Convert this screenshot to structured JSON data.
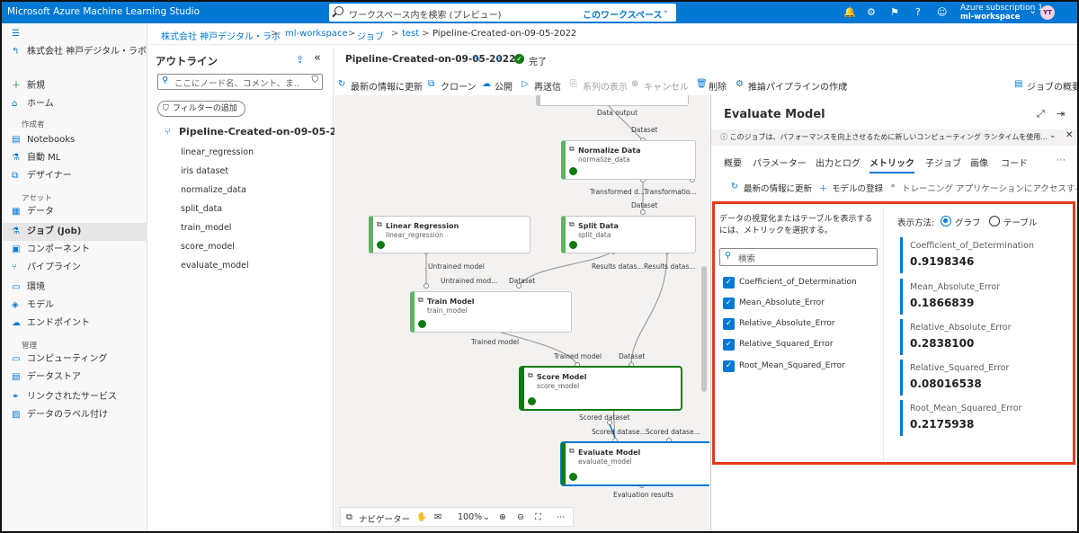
{
  "app": {
    "title": "Microsoft Azure Machine Learning Studio",
    "search_placeholder": "ワークスペース内を検索 (プレビュー)",
    "search_scope": "このワークスペース",
    "subscription": "Azure subscription 1",
    "workspace": "ml-workspace",
    "avatar_initials": "YT"
  },
  "breadcrumb": {
    "items": [
      "株式会社 神戸デジタル・ラボ",
      "ml-workspace",
      "ジョブ",
      "test",
      "Pipeline-Created-on-09-05-2022"
    ],
    "sep": ">"
  },
  "leftnav": {
    "org": "株式会社 神戸デジタル・ラボ",
    "new": "新規",
    "home": "ホーム",
    "section_author": "作成者",
    "notebooks": "Notebooks",
    "automl": "自動 ML",
    "designer": "デザイナー",
    "section_assets": "アセット",
    "data": "データ",
    "jobs": "ジョブ (Job)",
    "components": "コンポーネント",
    "pipelines": "パイプライン",
    "environments": "環境",
    "models": "モデル",
    "endpoints": "エンドポイント",
    "section_manage": "管理",
    "compute": "コンピューティング",
    "datastores": "データストア",
    "linked_services": "リンクされたサービス",
    "labeling": "データのラベル付け"
  },
  "outline": {
    "title": "アウトライン",
    "search_placeholder": "ここにノード名、コメント、ま...",
    "add_filter": "フィルターの追加",
    "pipeline_name": "Pipeline-Created-on-09-05-2022",
    "items": [
      "linear_regression",
      "iris dataset",
      "normalize_data",
      "split_data",
      "train_model",
      "score_model",
      "evaluate_model"
    ]
  },
  "canvas": {
    "pipeline_title": "Pipeline-Created-on-09-05-2022",
    "status": "完了",
    "toolbar": {
      "refresh": "最新の情報に更新",
      "clone": "クローン",
      "publish": "公開",
      "resubmit": "再送信",
      "view_lineage": "系列の表示",
      "cancel": "キャンセル",
      "delete": "削除",
      "create_inference": "推論パイプラインの作成",
      "job_overview": "ジョブの概要"
    },
    "labels": {
      "data_output": "Data output",
      "dataset": "Dataset",
      "transformed_data": "Transformed d...",
      "transformation": "Transformatio...",
      "untrained_model": "Untrained model",
      "untrained_model_short": "Untrained mod...",
      "results_dataset1": "Results datas...",
      "results_dataset2": "Results datas...",
      "trained_model": "Trained model",
      "scored_dataset": "Scored dataset",
      "scored_dataset1": "Scored datase...",
      "scored_dataset2": "Scored datase...",
      "evaluation_results": "Evaluation results"
    },
    "nodes": {
      "normalize": {
        "title": "Normalize Data",
        "sub": "normalize_data"
      },
      "linear": {
        "title": "Linear Regression",
        "sub": "linear_regression"
      },
      "split": {
        "title": "Split Data",
        "sub": "split_data"
      },
      "train": {
        "title": "Train Model",
        "sub": "train_model"
      },
      "score": {
        "title": "Score Model",
        "sub": "score_model"
      },
      "evaluate": {
        "title": "Evaluate Model",
        "sub": "evaluate_model"
      }
    },
    "navigator": {
      "label": "ナビゲーター",
      "zoom": "100%"
    }
  },
  "panel": {
    "title": "Evaluate Model",
    "banner": "このジョブは、パフォーマンスを向上させるために新しいコンピューティング ランタイムを使用...",
    "tabs": [
      "概要",
      "パラメーター",
      "出力とログ",
      "メトリック",
      "子ジョブ",
      "画像",
      "コード"
    ],
    "active_tab": "メトリック",
    "refresh": "最新の情報に更新",
    "register_model": "モデルの登録",
    "access_training_app": "トレーニング アプリケーションにアクセスする",
    "hint": "データの視覚化またはテーブルを表示するには、メトリックを選択する。",
    "search_placeholder": "検索",
    "display_label": "表示方法:",
    "opt_graph": "グラフ",
    "opt_table": "テーブル",
    "metrics": [
      {
        "name": "Coefficient_of_Determination",
        "value": "0.9198346"
      },
      {
        "name": "Mean_Absolute_Error",
        "value": "0.1866839"
      },
      {
        "name": "Relative_Absolute_Error",
        "value": "0.2838100"
      },
      {
        "name": "Relative_Squared_Error",
        "value": "0.08016538"
      },
      {
        "name": "Root_Mean_Squared_Error",
        "value": "0.2175938"
      }
    ]
  },
  "colors": {
    "brand": "#0078d4",
    "success": "#107c10",
    "highlight": "#e53b1b"
  }
}
